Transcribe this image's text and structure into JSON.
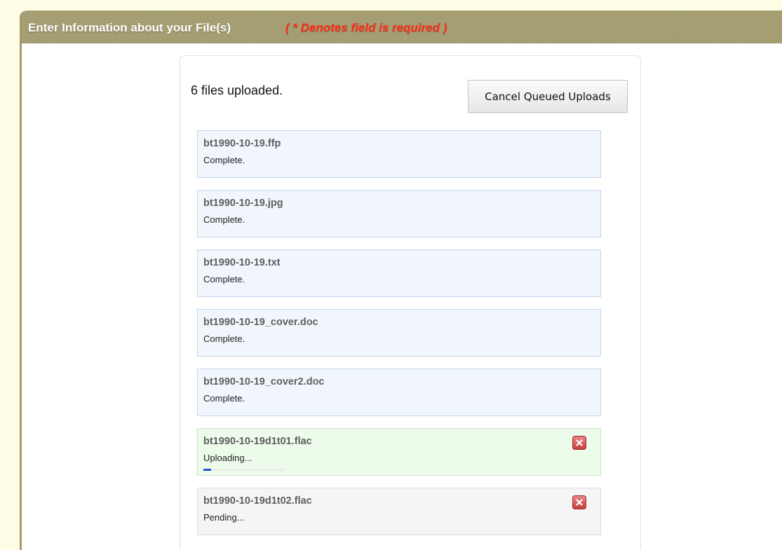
{
  "header": {
    "title": "Enter Information about your File(s)",
    "required_note": "( * Denotes field is required )"
  },
  "uploader": {
    "status": "6 files uploaded.",
    "cancel_button_label": "Cancel Queued Uploads",
    "files": [
      {
        "name": "bt1990-10-19.ffp",
        "state": "Complete.",
        "status": "complete"
      },
      {
        "name": "bt1990-10-19.jpg",
        "state": "Complete.",
        "status": "complete"
      },
      {
        "name": "bt1990-10-19.txt",
        "state": "Complete.",
        "status": "complete"
      },
      {
        "name": "bt1990-10-19_cover.doc",
        "state": "Complete.",
        "status": "complete"
      },
      {
        "name": "bt1990-10-19_cover2.doc",
        "state": "Complete.",
        "status": "complete"
      },
      {
        "name": "bt1990-10-19d1t01.flac",
        "state": "Uploading...",
        "status": "uploading",
        "progress": 0.02,
        "cancel_icon": "close-icon"
      },
      {
        "name": "bt1990-10-19d1t02.flac",
        "state": "Pending...",
        "status": "pending",
        "cancel_icon": "close-icon"
      }
    ]
  },
  "colors": {
    "header_bg": "#a39c70",
    "required_text": "#ff2a1a",
    "complete_bg": "#f1f6fd",
    "uploading_bg": "#ecfbea",
    "pending_bg": "#f5f5f5",
    "progress": "#1b55d8"
  }
}
